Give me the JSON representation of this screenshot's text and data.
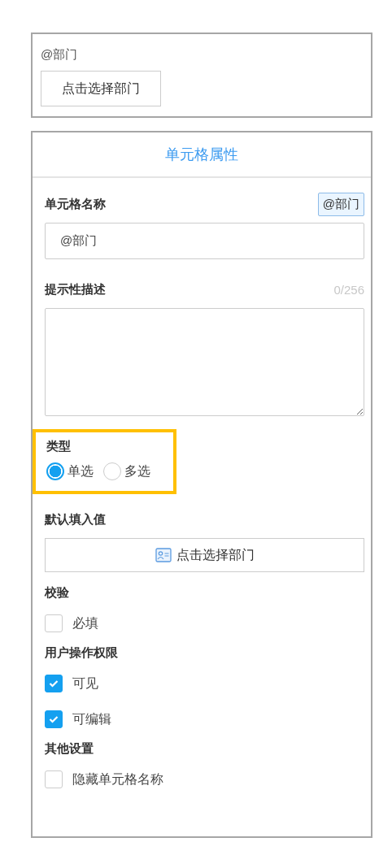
{
  "preview": {
    "label": "@部门",
    "button": "点击选择部门"
  },
  "panel": {
    "title": "单元格属性",
    "name_field": {
      "label": "单元格名称",
      "tag": "@部门",
      "value": "@部门"
    },
    "description": {
      "label": "提示性描述",
      "counter": "0/256"
    },
    "type": {
      "label": "类型",
      "highlighted": true,
      "options": [
        {
          "label": "单选",
          "selected": true
        },
        {
          "label": "多选",
          "selected": false
        }
      ]
    },
    "default_value": {
      "label": "默认填入值",
      "button": "点击选择部门"
    },
    "sections": [
      {
        "title": "校验",
        "options": [
          {
            "label": "必填",
            "checked": false
          }
        ]
      },
      {
        "title": "用户操作权限",
        "options": [
          {
            "label": "可见",
            "checked": true
          },
          {
            "label": "可编辑",
            "checked": true
          }
        ]
      },
      {
        "title": "其他设置",
        "options": [
          {
            "label": "隐藏单元格名称",
            "checked": false
          }
        ]
      }
    ]
  }
}
